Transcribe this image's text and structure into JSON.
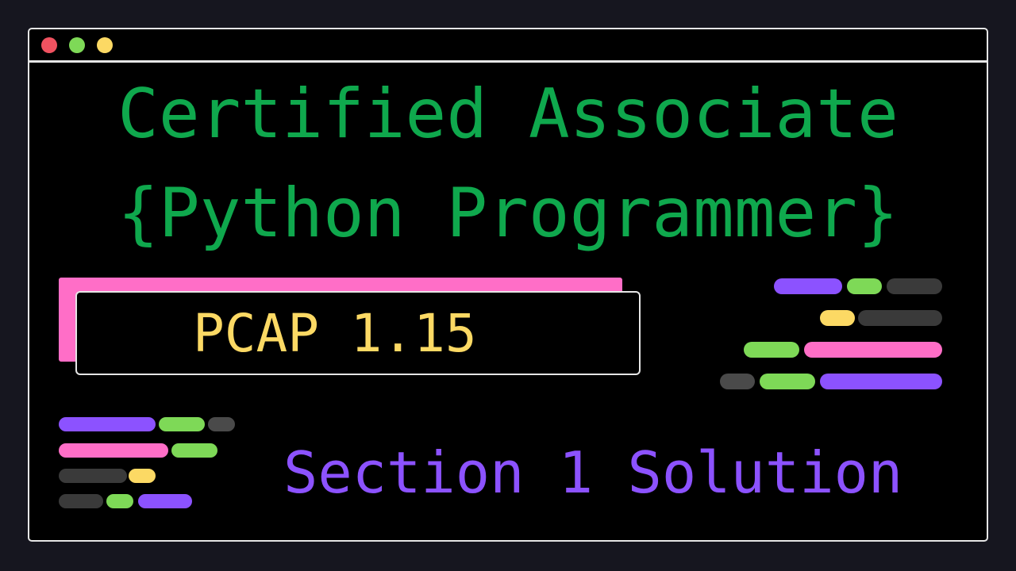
{
  "window": {
    "controls": [
      {
        "name": "close",
        "color": "#f05260"
      },
      {
        "name": "minimize",
        "color": "#7ed957"
      },
      {
        "name": "maximize",
        "color": "#fcd964"
      }
    ]
  },
  "title": {
    "line1": "Certified Associate",
    "line2": "{Python Programmer}"
  },
  "code_box": {
    "label": "PCAP 1.15"
  },
  "subtitle": "Section 1 Solution",
  "colors": {
    "title": "#0fa84d",
    "code_label": "#fcd964",
    "subtitle": "#8c52ff",
    "accent_pink": "#ff6ec7",
    "accent_green": "#7ed957",
    "accent_purple": "#8c52ff",
    "accent_yellow": "#fcd964",
    "accent_gray": "#3a3a3a"
  }
}
